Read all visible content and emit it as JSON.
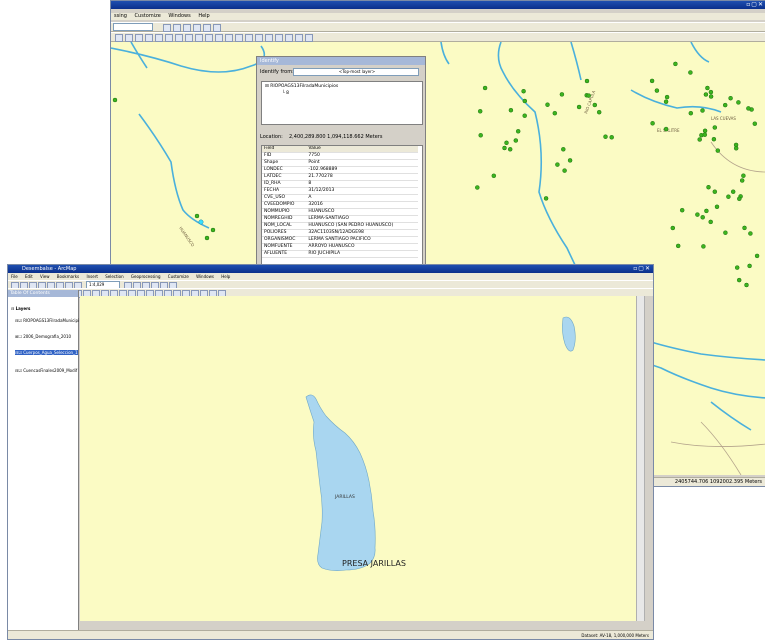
{
  "bg_window": {
    "menu": [
      "ssing",
      "Customize",
      "Windows",
      "Help"
    ],
    "status_coords": "2405744.706  1092002.395 Meters",
    "map_labels": [
      "HUANUSCO",
      "EL SALITRE",
      "LAS CUEVAS",
      "RIO CAPULA"
    ],
    "river_color": "#4ab0dc",
    "point_color": "#3cb41e"
  },
  "identify": {
    "title": "Identify",
    "identify_from_label": "Identify from:",
    "identify_from_value": "<Top-most layer>",
    "tree_root": "RIOPOAGS13FilradaMunicipios",
    "tree_child": "8",
    "location_label": "Location:",
    "location_value": "2,400,289.800  1,094,118.662 Meters",
    "columns": [
      "Field",
      "Value"
    ],
    "rows": [
      [
        "FID",
        "7750"
      ],
      [
        "Shape",
        "Point"
      ],
      [
        "LONDEC",
        "-102.968889"
      ],
      [
        "LATDEC",
        "21.770278"
      ],
      [
        "ID_RHA",
        "8"
      ],
      [
        "FECHA",
        "31/12/2013"
      ],
      [
        "CVE_USO",
        "A"
      ],
      [
        "CVEEDOMPIO",
        "32016"
      ],
      [
        "NOMMUPIO",
        "HUANUSCO"
      ],
      [
        "NOMREGHID",
        "LERMA-SANTIAGO"
      ],
      [
        "NOM_LOCAL",
        "HUANUSCO (SAN PEDRO HUANUSCO)"
      ],
      [
        "POLIORES",
        "32AC1103SN/12ADGE98"
      ],
      [
        "ORGANISMOC",
        "LERMA SANTIAGO PACIFICO"
      ],
      [
        "NOMFUENTE",
        "ARROYO HUANUSCO"
      ],
      [
        "AFLUENTE",
        "RIO JUCHIPILA"
      ]
    ]
  },
  "fg_window": {
    "title": "Desembalse - ArcMap",
    "menu": [
      "File",
      "Edit",
      "View",
      "Bookmarks",
      "Insert",
      "Selection",
      "Geoprocessing",
      "Customize",
      "Windows",
      "Help"
    ],
    "scale": "1:4,029",
    "toc_title": "Table Of Contents",
    "toc_items": [
      "Layers",
      "RIOPOAGS13FilradaMunicipi",
      "2006_Demografia_2010",
      "Cuerpos_Agua_Seleccion_1",
      "CuencasFinales2009_Modif"
    ],
    "map_labels": [
      "JARILLAS",
      "PRESA JARILLAS"
    ],
    "status": "Dataset: AV-18, 1,000,000 Meters",
    "water_color": "#a9d6f0",
    "map_bg": "#fbfbc4"
  }
}
